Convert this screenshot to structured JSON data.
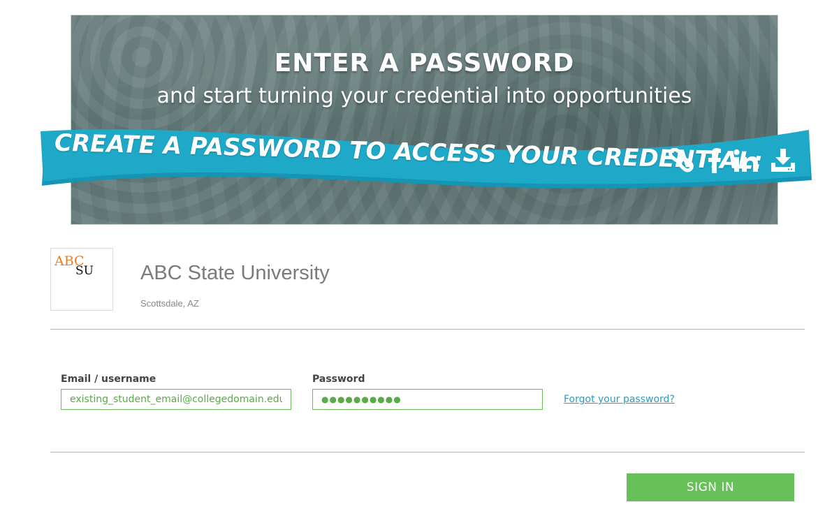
{
  "banner": {
    "title": "ENTER A PASSWORD",
    "subtitle": "and start turning your credential into opportunities",
    "ribbon_text": "CREATE A PASSWORD TO ACCESS YOUR CREDENTIAL:",
    "ribbon_color": "#1fa9c9",
    "icons": [
      "link-icon",
      "facebook-icon",
      "linkedin-icon",
      "download-icon"
    ]
  },
  "school": {
    "logo_text_top": "ABC",
    "logo_text_bottom": "SU",
    "name": "ABC State University",
    "location": "Scottsdale, AZ"
  },
  "form": {
    "email_label": "Email / username",
    "email_value": "existing_student_email@collegedomain.edu",
    "password_label": "Password",
    "password_value": "●●●●●●●●●●",
    "forgot_link": "Forgot your password?"
  },
  "actions": {
    "signin_label": "SIGN IN"
  },
  "colors": {
    "accent_green": "#68c059",
    "link_blue": "#2f9bc1",
    "logo_orange": "#f07d1e"
  }
}
